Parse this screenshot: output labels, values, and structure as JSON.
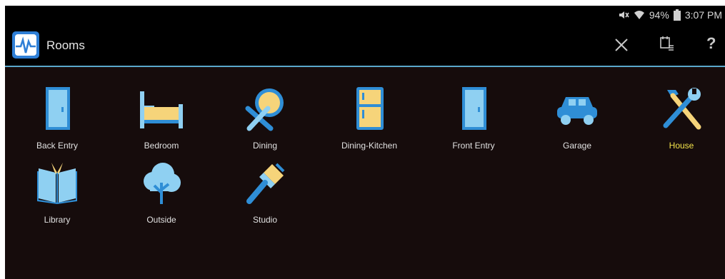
{
  "status": {
    "battery_percent": "94%",
    "time": "3:07 PM"
  },
  "app": {
    "title": "Rooms"
  },
  "toolbar": {
    "help_label": "?"
  },
  "rooms": [
    {
      "label": "Back Entry",
      "icon": "door-icon",
      "selected": false
    },
    {
      "label": "Bedroom",
      "icon": "bed-icon",
      "selected": false
    },
    {
      "label": "Dining",
      "icon": "plate-fork-knife-icon",
      "selected": false
    },
    {
      "label": "Dining-Kitchen",
      "icon": "refrigerator-icon",
      "selected": false
    },
    {
      "label": "Front Entry",
      "icon": "door-icon",
      "selected": false
    },
    {
      "label": "Garage",
      "icon": "car-icon",
      "selected": false
    },
    {
      "label": "House",
      "icon": "hammer-wrench-icon",
      "selected": true
    },
    {
      "label": "Library",
      "icon": "book-icon",
      "selected": false
    },
    {
      "label": "Outside",
      "icon": "tree-icon",
      "selected": false
    },
    {
      "label": "Studio",
      "icon": "paintbrush-icon",
      "selected": false
    }
  ],
  "colors": {
    "accent": "#5aa8cc",
    "selected_label": "#f2e24a",
    "icon_blue": "#2f8ed6",
    "icon_light_blue": "#8fd0f2",
    "icon_yellow": "#f6d47a"
  }
}
